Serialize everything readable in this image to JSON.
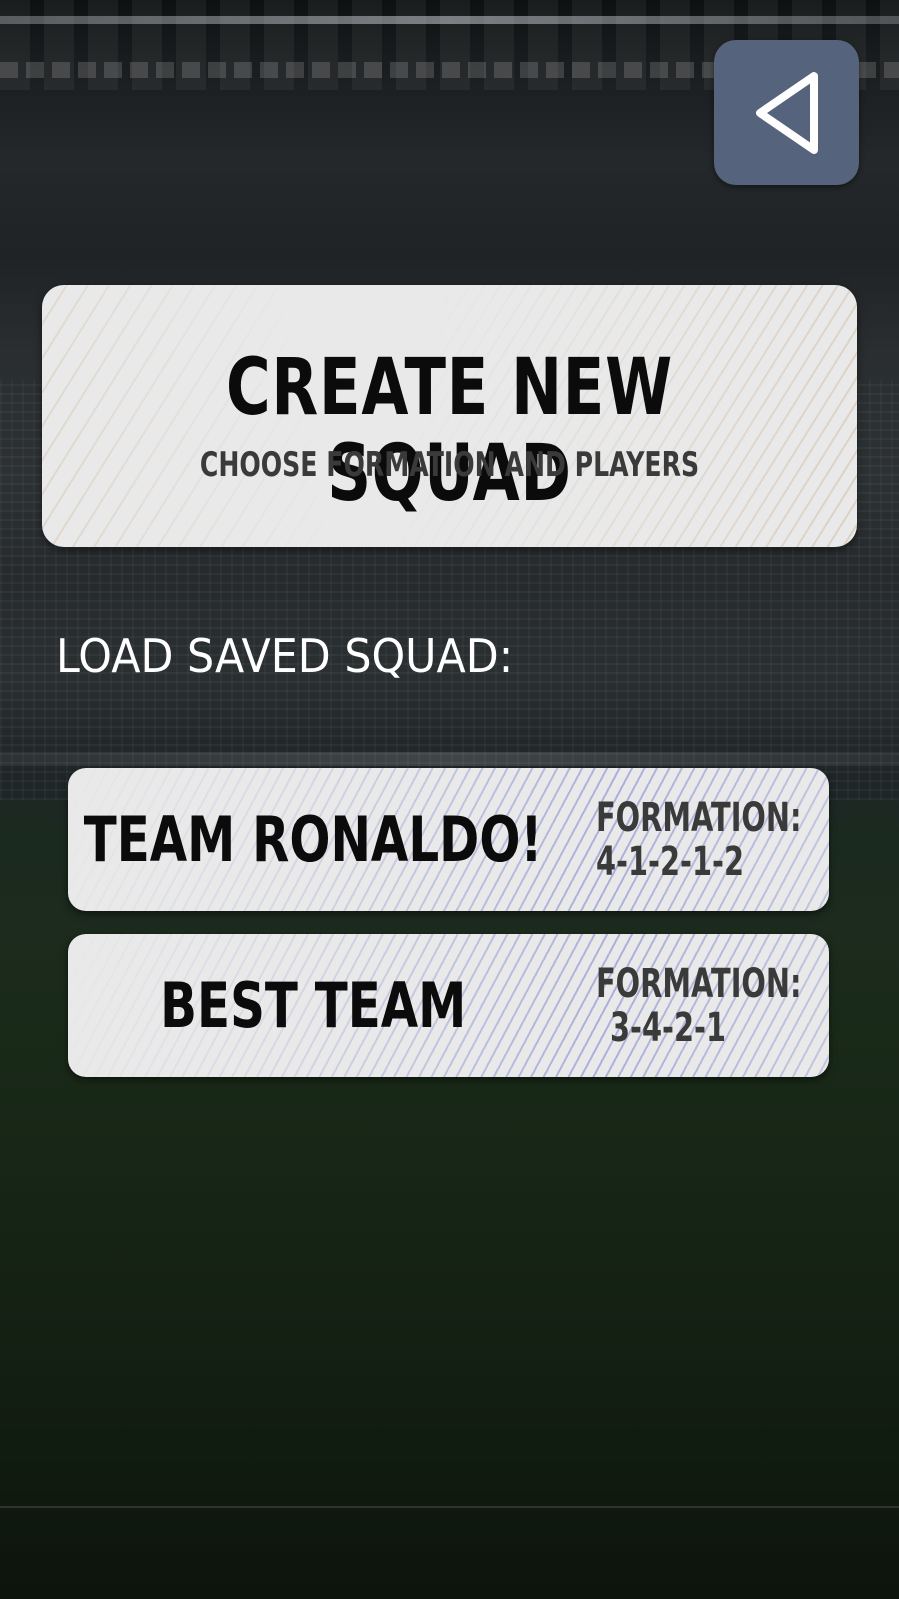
{
  "header": {
    "back_icon": "back-triangle-icon"
  },
  "create": {
    "title": "CREATE NEW SQUAD",
    "subtitle": "CHOOSE FORMATION AND PLAYERS"
  },
  "saved": {
    "label": "LOAD SAVED SQUAD:",
    "squads": [
      {
        "name": "TEAM RONALDO!",
        "formation_label": "FORMATION:",
        "formation": "4-1-2-1-2"
      },
      {
        "name": "BEST TEAM",
        "formation_label": "FORMATION:",
        "formation": "3-4-2-1"
      }
    ]
  },
  "colors": {
    "back_button": "#55637c",
    "card": "#e9e9e9",
    "create_stripe": "#cdb496",
    "squad_stripe": "#7882cd"
  }
}
